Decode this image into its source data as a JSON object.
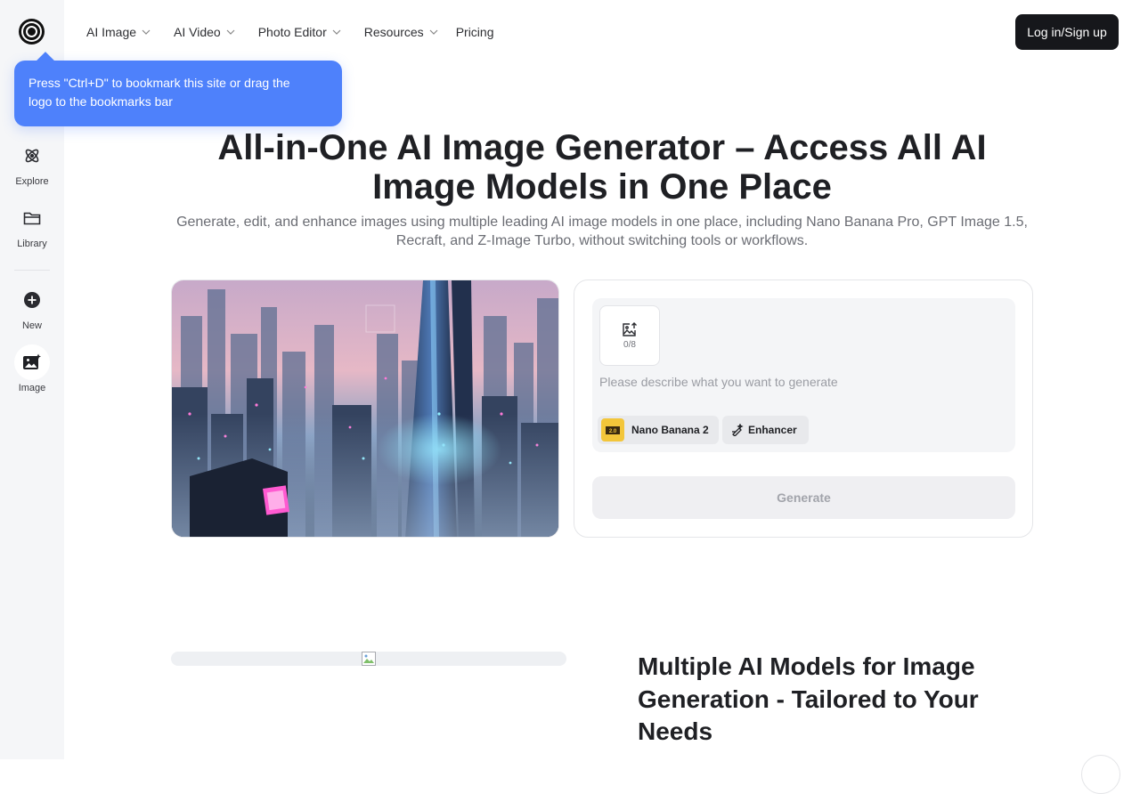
{
  "brand": {
    "logo_icon": "spiral-logo-icon"
  },
  "nav": {
    "items": [
      {
        "label": "AI Image",
        "has_dropdown": true
      },
      {
        "label": "AI Video",
        "has_dropdown": true
      },
      {
        "label": "Photo Editor",
        "has_dropdown": true
      },
      {
        "label": "Resources",
        "has_dropdown": true
      },
      {
        "label": "Pricing",
        "has_dropdown": false
      }
    ],
    "login_label": "Log in/Sign up"
  },
  "sidebar": {
    "items": [
      {
        "label": "Explore",
        "icon": "atom-icon"
      },
      {
        "label": "Library",
        "icon": "folder-icon"
      },
      {
        "label": "New",
        "icon": "plus-circle-icon"
      },
      {
        "label": "Image",
        "icon": "image-sparkle-icon",
        "active": true
      }
    ]
  },
  "tooltip": {
    "text": "Press \"Ctrl+D\" to bookmark this site or drag the logo to the bookmarks bar",
    "color": "#4e81fb"
  },
  "hero": {
    "title": "All-in-One AI Image Generator – Access All AI Image Models in One Place",
    "subtitle": "Generate, edit, and enhance images using multiple leading AI image models in one place, including Nano Banana Pro, GPT Image 1.5, Recraft, and Z-Image Turbo, without switching tools or workflows."
  },
  "generator": {
    "upload_count": "0/8",
    "prompt_placeholder": "Please describe what you want to generate",
    "model_label": "Nano Banana 2",
    "enhancer_label": "Enhancer",
    "generate_label": "Generate"
  },
  "section2": {
    "title": "Multiple AI Models for Image Generation - Tailored to Your Needs"
  },
  "colors": {
    "primary_dark": "#16171b",
    "accent_blue": "#4e81fb",
    "sidebar_bg": "#f5f6f8"
  }
}
